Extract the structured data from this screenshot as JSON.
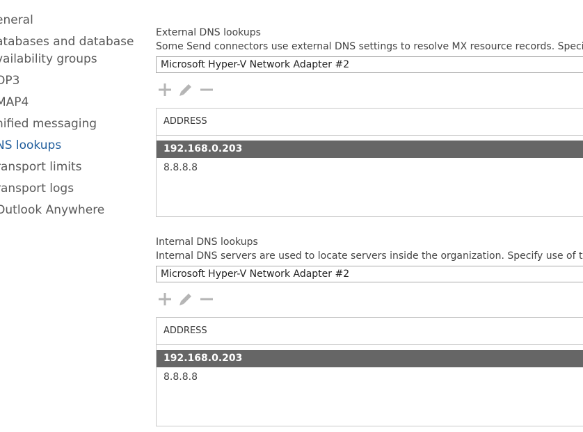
{
  "nav": {
    "items": [
      {
        "label": "eneral"
      },
      {
        "label": "atabases and database vailability groups"
      },
      {
        "label": "OP3"
      },
      {
        "label": "MAP4"
      },
      {
        "label": "nified messaging"
      },
      {
        "label": "NS lookups"
      },
      {
        "label": "ransport limits"
      },
      {
        "label": "ransport logs"
      },
      {
        "label": "Outlook Anywhere"
      }
    ]
  },
  "external": {
    "title": "External DNS lookups",
    "description": "Some Send connectors use external DNS settings to resolve MX resource records. Specify use",
    "adapter": "Microsoft Hyper-V Network Adapter #2",
    "column_header": "ADDRESS",
    "rows": [
      "192.168.0.203",
      "8.8.8.8"
    ]
  },
  "internal": {
    "title": "Internal DNS lookups",
    "description": "Internal DNS servers are used to locate servers inside the organization. Specify use of the DN",
    "adapter": "Microsoft Hyper-V Network Adapter #2",
    "column_header": "ADDRESS",
    "rows": [
      "192.168.0.203",
      "8.8.8.8"
    ]
  },
  "icons": {
    "add": "plus-icon",
    "edit": "pencil-icon",
    "remove": "minus-icon"
  },
  "colors": {
    "selected_nav": "#1f5d9c",
    "selected_row": "#666666",
    "toolbar_icon": "#b5b5b5"
  }
}
